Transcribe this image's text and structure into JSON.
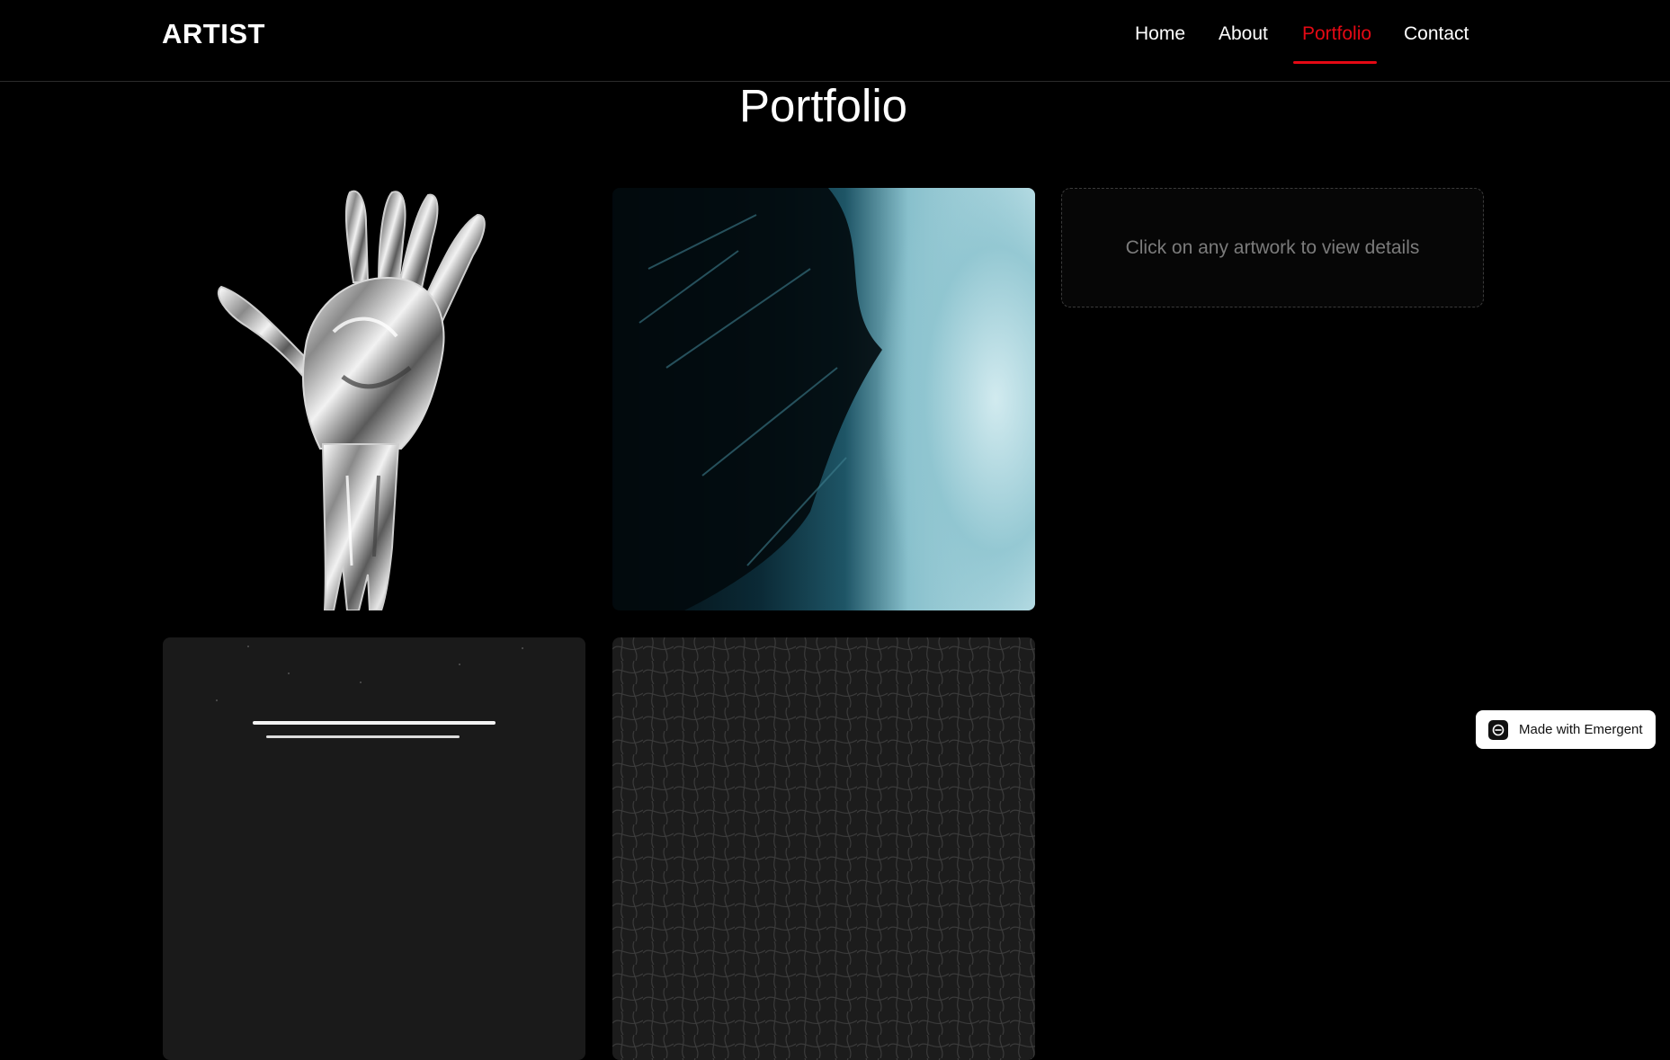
{
  "header": {
    "logo": "ARTIST",
    "nav": [
      {
        "label": "Home"
      },
      {
        "label": "About"
      },
      {
        "label": "Portfolio",
        "active": true
      },
      {
        "label": "Contact"
      }
    ]
  },
  "main": {
    "title": "Portfolio",
    "detail_panel": {
      "text": "Click on any artwork to view details"
    }
  },
  "badge": {
    "label": "Made with Emergent"
  },
  "colors": {
    "background": "#000000",
    "accent": "#e50914",
    "text": "#ffffff",
    "muted_text": "#7b7b7b"
  },
  "icons": {
    "badge": "emergent-logo-icon"
  }
}
